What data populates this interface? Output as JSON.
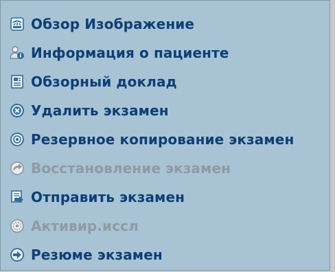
{
  "menu": {
    "items": [
      {
        "label": "Обзор Изображение",
        "icon": "image-review-icon",
        "enabled": true
      },
      {
        "label": "Информация о пациенте",
        "icon": "patient-info-icon",
        "enabled": true
      },
      {
        "label": "Обзорный доклад",
        "icon": "report-icon",
        "enabled": true
      },
      {
        "label": "Удалить экзамен",
        "icon": "delete-icon",
        "enabled": true
      },
      {
        "label": "Резервное копирование экзамен",
        "icon": "backup-disc-icon",
        "enabled": true
      },
      {
        "label": "Восстановление экзамен",
        "icon": "restore-icon",
        "enabled": false
      },
      {
        "label": "Отправить экзамен",
        "icon": "send-icon",
        "enabled": true
      },
      {
        "label": "Активир.иссл",
        "icon": "activate-icon",
        "enabled": false
      },
      {
        "label": "Резюме экзамен",
        "icon": "resume-arrow-icon",
        "enabled": true
      }
    ]
  },
  "colors": {
    "panel_bg": "#a8c4d4",
    "label_enabled": "#0b3f75",
    "label_disabled": "#8f9aa2"
  }
}
